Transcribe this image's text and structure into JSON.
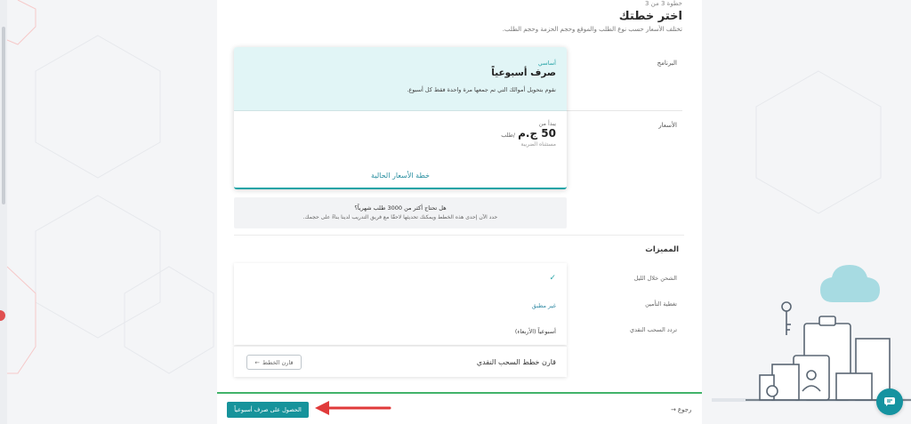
{
  "header": {
    "step": "خطوة 3 من 3",
    "title": "اختر خطتك",
    "subtitle": "تختلف الأسعار حسب نوع الطلب والموقع وحجم الحزمة وحجم الطلب."
  },
  "rows": {
    "program_label": "البرنامج",
    "prices_label": "الأسعار"
  },
  "plan": {
    "tag": "أساسي",
    "name": "صرف أسبوعياً",
    "description": "نقوم بتحويل أموالك التي تم جمعها مرة واحدة فقط كل أسبوع.",
    "starts_from": "يبدأ من",
    "price": "50 ج.م",
    "per": "/طلب",
    "tax_note": "مستثناه الضريبة",
    "current_prices_link": "خطة الأسعار الحالية"
  },
  "info": {
    "question": "هل تحتاج أكثر من 3000 طلب شهرياً؟",
    "text": "حدد الآن إحدى هذه الخطط ويمكنك تحديثها لاحقًا مع فريق التدريب لدينا بناءً على حجمك."
  },
  "features": {
    "title": "المميزات",
    "labels": [
      "الشحن خلال الليل",
      "تغطية التأمين",
      "تردد السحب النقدي"
    ],
    "values": {
      "check": "✓",
      "not_applicable": "غير مطبق",
      "weekly": "أسبوعياً (الأربعاء)"
    }
  },
  "compare": {
    "label": "قارن خطط السحب النقدي",
    "button": "قارن الخطط"
  },
  "footer": {
    "back": "رجوع",
    "cta": "الحصول على صرف أسبوعياً"
  },
  "colors": {
    "accent": "#16939b",
    "footer_border": "#41b36a",
    "annotation_arrow": "#e03a3a"
  }
}
